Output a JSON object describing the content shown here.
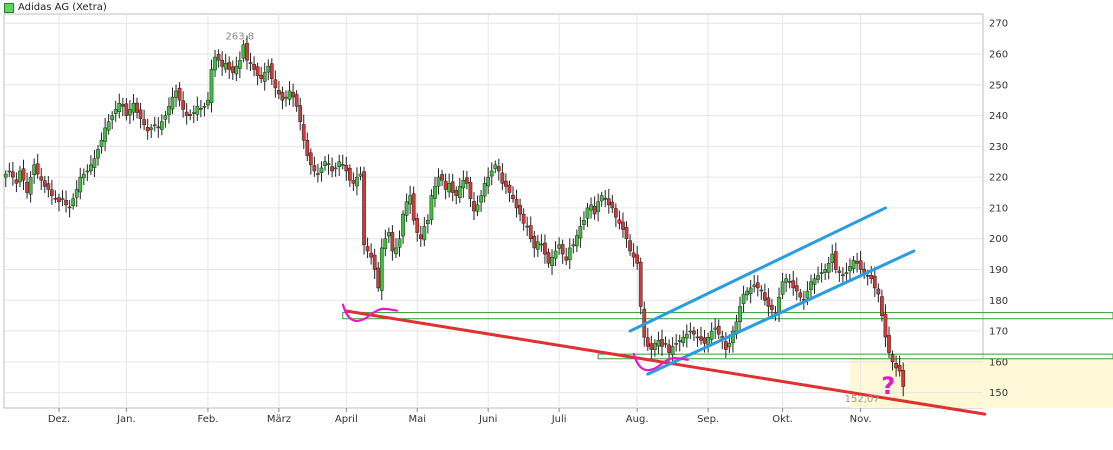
{
  "chart_data": {
    "type": "candlestick",
    "legend": {
      "label": "Adidas AG (Xetra)",
      "color": "#5cd65c"
    },
    "ylim": [
      145,
      273
    ],
    "y_ticks": [
      150,
      160,
      170,
      180,
      190,
      200,
      210,
      220,
      230,
      240,
      250,
      260,
      270
    ],
    "x_months": [
      {
        "label": "Dez.",
        "index": 15
      },
      {
        "label": "Jan.",
        "index": 34
      },
      {
        "label": "Feb.",
        "index": 57
      },
      {
        "label": "März",
        "index": 77
      },
      {
        "label": "April",
        "index": 96
      },
      {
        "label": "Mai",
        "index": 116
      },
      {
        "label": "Juni",
        "index": 136
      },
      {
        "label": "Juli",
        "index": 156
      },
      {
        "label": "Aug.",
        "index": 178
      },
      {
        "label": "Sep.",
        "index": 198
      },
      {
        "label": "Okt.",
        "index": 219
      },
      {
        "label": "Nov.",
        "index": 241
      }
    ],
    "n_days": 276,
    "annotations": {
      "high_label": "263,8",
      "high_value": 263.8,
      "high_index": 66,
      "low_label": "152,07",
      "low_value": 152.07,
      "low_index": 242,
      "question_mark": "?"
    },
    "close": [
      221,
      222,
      220,
      218,
      222,
      219,
      215,
      220,
      224,
      221,
      219,
      217,
      216,
      214,
      213,
      212,
      213,
      211,
      210,
      213,
      216,
      220,
      221,
      222,
      224,
      226,
      229,
      232,
      236,
      238,
      240,
      242,
      244,
      243,
      240,
      242,
      244,
      241,
      239,
      237,
      235,
      236,
      237,
      236,
      238,
      240,
      243,
      246,
      248,
      245,
      242,
      240,
      240,
      241,
      243,
      242,
      243,
      245,
      255,
      259,
      258,
      256,
      257,
      255,
      254,
      256,
      258,
      263,
      258,
      257,
      255,
      253,
      252,
      254,
      256,
      252,
      249,
      247,
      245,
      246,
      248,
      246,
      243,
      238,
      232,
      227,
      224,
      222,
      221,
      223,
      225,
      224,
      222,
      223,
      225,
      224,
      222,
      219,
      218,
      220,
      221,
      198,
      196,
      194,
      190,
      184,
      197,
      200,
      202,
      196,
      197,
      200,
      208,
      212,
      214,
      206,
      202,
      200,
      204,
      206,
      214,
      217,
      220,
      219,
      216,
      218,
      215,
      214,
      217,
      219,
      218,
      213,
      209,
      211,
      214,
      218,
      220,
      222,
      224,
      222,
      218,
      217,
      215,
      213,
      210,
      208,
      205,
      204,
      200,
      197,
      199,
      198,
      195,
      192,
      194,
      196,
      198,
      195,
      193,
      197,
      198,
      201,
      204,
      206,
      210,
      211,
      208,
      212,
      214,
      213,
      211,
      210,
      207,
      205,
      203,
      200,
      196,
      194,
      192,
      178,
      168,
      165,
      164,
      166,
      167,
      165,
      166,
      163,
      165,
      166,
      167,
      168,
      169,
      170,
      169,
      168,
      167,
      166,
      168,
      170,
      171,
      169,
      167,
      164,
      166,
      170,
      173,
      178,
      182,
      183,
      184,
      185,
      184,
      183,
      180,
      178,
      177,
      176,
      181,
      186,
      187,
      186,
      184,
      183,
      181,
      180,
      183,
      186,
      187,
      188,
      189,
      190,
      192,
      195,
      190,
      189,
      188,
      189,
      191,
      193,
      192,
      190,
      189,
      188,
      187,
      184,
      182,
      175,
      168,
      163,
      160,
      158,
      157,
      152
    ],
    "lines": {
      "support_trend": {
        "from": [
          96,
          176.5
        ],
        "to": [
          276,
          143
        ],
        "color": "#e03030"
      },
      "channel_upper": {
        "from": [
          176,
          170
        ],
        "to": [
          248,
          210
        ],
        "color": "#2a9de0"
      },
      "channel_lower": {
        "from": [
          181,
          156
        ],
        "to": [
          256,
          196
        ],
        "color": "#2a9de0"
      },
      "horizontal_levels": [
        {
          "y1": 174,
          "y2": 176,
          "from_index": 95,
          "color": "#3a9a3a"
        },
        {
          "y1": 161,
          "y2": 162.5,
          "from_index": 167,
          "color": "#3a9a3a"
        }
      ],
      "shaded_zone": {
        "y_top": 161,
        "from_index": 238,
        "color": "#fff8d6"
      }
    },
    "magenta_marks": [
      {
        "at_index": 99,
        "value": 176
      },
      {
        "at_index": 181,
        "value": 160
      }
    ]
  }
}
